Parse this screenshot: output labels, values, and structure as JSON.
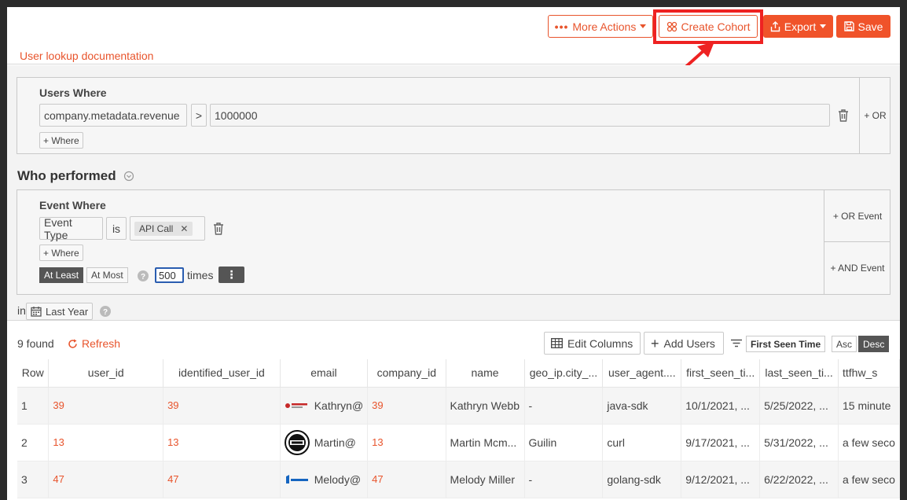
{
  "header": {
    "more_actions": "More Actions",
    "create_cohort": "Create Cohort",
    "export": "Export",
    "save": "Save",
    "doc_link": "User lookup documentation"
  },
  "users_where": {
    "title": "Users Where",
    "field": "company.metadata.revenue",
    "operator": ">",
    "value": "1000000",
    "add_where": "+ Where",
    "or_label": "+ OR"
  },
  "who_performed": {
    "title": "Who performed",
    "event_title": "Event Where",
    "field": "Event Type",
    "operator": "is",
    "tag": "API Call",
    "add_where": "+ Where",
    "at_least": "At Least",
    "at_most": "At Most",
    "times_value": "500",
    "times_label": "times",
    "or_event": "+ OR Event",
    "and_event": "+ AND Event",
    "in_label": "in",
    "period": "Last Year"
  },
  "results": {
    "found": "9 found",
    "refresh": "Refresh",
    "edit_columns": "Edit Columns",
    "add_users": "Add Users",
    "sort_field": "First Seen Time",
    "asc": "Asc",
    "desc": "Desc"
  },
  "table": {
    "columns": [
      "Row",
      "user_id",
      "identified_user_id",
      "email",
      "company_id",
      "name",
      "geo_ip.city_...",
      "user_agent....",
      "first_seen_ti...",
      "last_seen_ti...",
      "ttfhw_s"
    ],
    "rows": [
      {
        "row": "1",
        "user_id": "39",
        "identified_user_id": "39",
        "email": "Kathryn@",
        "company_id": "39",
        "name": "Kathryn Webb",
        "city": "-",
        "agent": "java-sdk",
        "first_seen": "10/1/2021, ...",
        "last_seen": "5/25/2022, ...",
        "ttfhw": "15 minute"
      },
      {
        "row": "2",
        "user_id": "13",
        "identified_user_id": "13",
        "email": "Martin@",
        "company_id": "13",
        "name": "Martin Mcm...",
        "city": "Guilin",
        "agent": "curl",
        "first_seen": "9/17/2021, ...",
        "last_seen": "5/31/2022, ...",
        "ttfhw": "a few seco"
      },
      {
        "row": "3",
        "user_id": "47",
        "identified_user_id": "47",
        "email": "Melody@",
        "company_id": "47",
        "name": "Melody Miller",
        "city": "-",
        "agent": "golang-sdk",
        "first_seen": "9/12/2021, ...",
        "last_seen": "6/22/2022, ...",
        "ttfhw": "a few seco"
      }
    ]
  },
  "colors": {
    "accent": "#f0532a",
    "highlight": "#ee2222"
  }
}
